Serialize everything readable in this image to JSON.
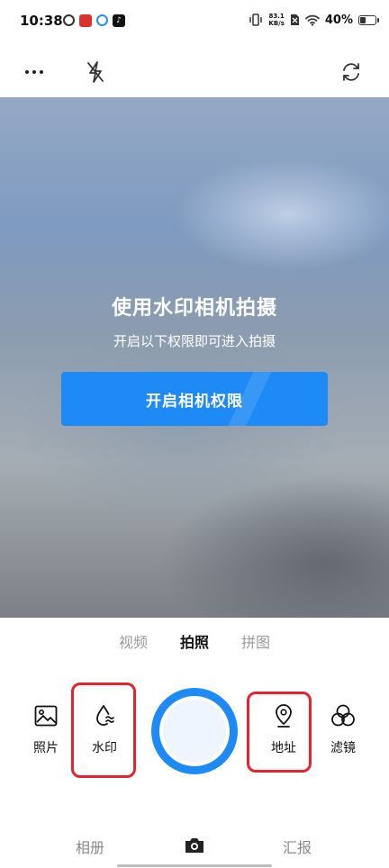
{
  "status_bar": {
    "time": "10:38",
    "net_speed_value": "83.1",
    "net_speed_unit": "KB/s",
    "battery": "40%",
    "battery_level": 0.4
  },
  "toolbar": {
    "icons": [
      "more-icon",
      "flash-off-icon",
      "switch-camera-icon"
    ]
  },
  "preview": {
    "title": "使用水印相机拍摄",
    "subtitle": "开启以下权限即可进入拍摄",
    "permission_button": "开启相机权限"
  },
  "modes": {
    "items": [
      "视频",
      "拍照",
      "拼图"
    ],
    "active": "拍照"
  },
  "controls": {
    "photos": "照片",
    "watermark": "水印",
    "address": "地址",
    "filter": "滤镜"
  },
  "bottom_nav": {
    "album": "相册",
    "report": "汇报"
  },
  "colors": {
    "accent": "#1e8af5",
    "highlight": "#e8222e"
  }
}
